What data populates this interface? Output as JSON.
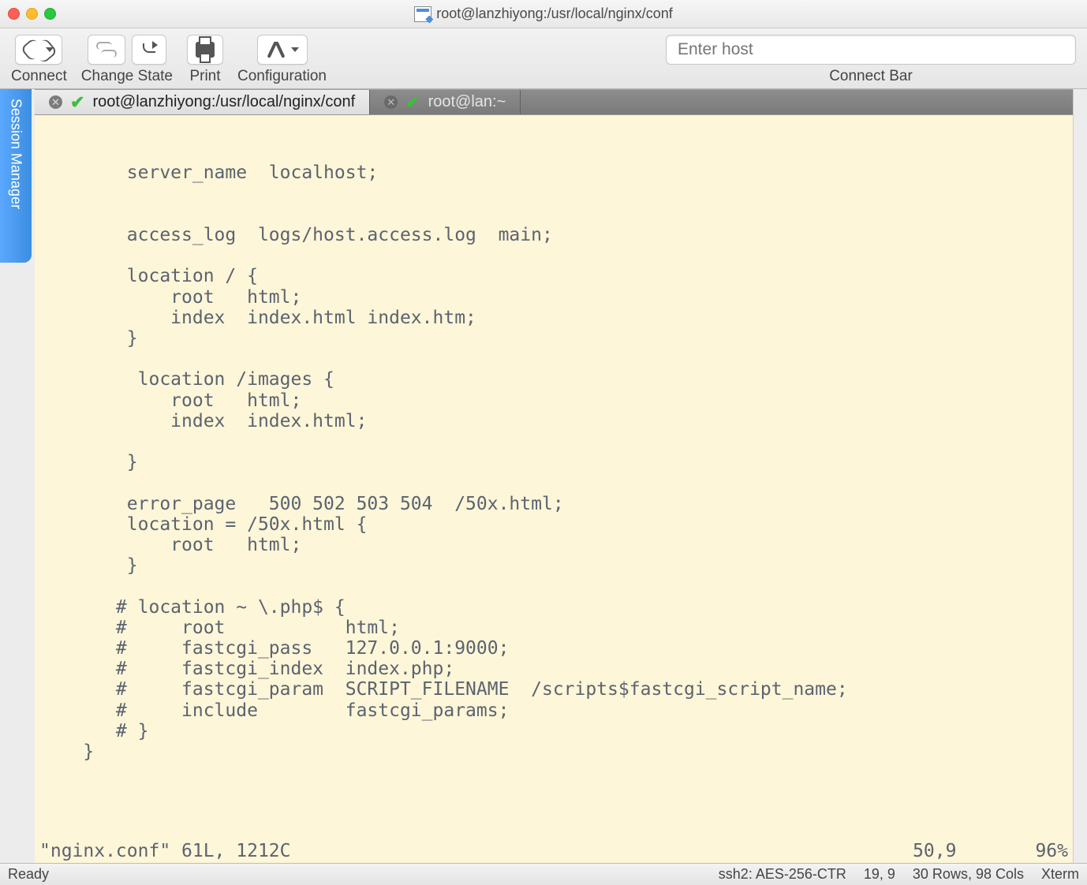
{
  "window": {
    "title": "root@lanzhiyong:/usr/local/nginx/conf"
  },
  "toolbar": {
    "connect": "Connect",
    "change_state": "Change State",
    "print": "Print",
    "configuration": "Configuration",
    "connect_bar": "Connect Bar",
    "host_placeholder": "Enter host"
  },
  "session_manager": {
    "label": "Session Manager"
  },
  "tabs": [
    {
      "label": "root@lanzhiyong:/usr/local/nginx/conf",
      "active": true
    },
    {
      "label": "root@lan:~",
      "active": false
    }
  ],
  "terminal": {
    "lines": [
      "        server_name  localhost;",
      "",
      "",
      "        access_log  logs/host.access.log  main;",
      "",
      "        location / {",
      "            root   html;",
      "            index  index.html index.htm;",
      "        }",
      "",
      "         location /images {",
      "            root   html;",
      "            index  index.html;",
      "",
      "        }",
      "",
      "        error_page   500 502 503 504  /50x.html;",
      "        location = /50x.html {",
      "            root   html;",
      "        }",
      "",
      "       # location ~ \\.php$ {",
      "       #     root           html;",
      "       #     fastcgi_pass   127.0.0.1:9000;",
      "       #     fastcgi_index  index.php;",
      "       #     fastcgi_param  SCRIPT_FILENAME  /scripts$fastcgi_script_name;",
      "       #     include        fastcgi_params;",
      "       # }",
      "    }"
    ],
    "vim_filename": "\"nginx.conf\" 61L, 1212C",
    "vim_pos": "50,9",
    "vim_pct": "96%"
  },
  "statusbar": {
    "left": "Ready",
    "ssh": "ssh2: AES-256-CTR",
    "cursor": "19, 9",
    "dims": "30 Rows, 98 Cols",
    "term": "Xterm"
  }
}
